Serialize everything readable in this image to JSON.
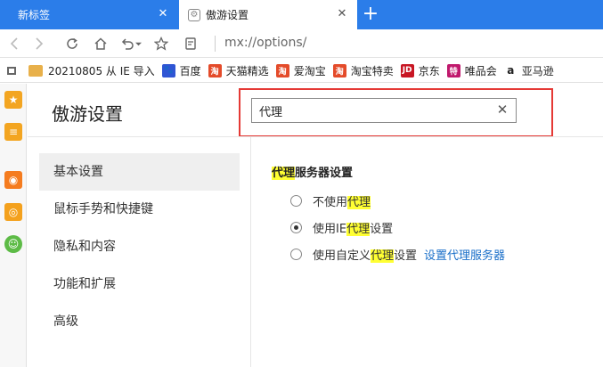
{
  "tabs": [
    {
      "title": "新标签",
      "close": "✕"
    },
    {
      "title": "傲游设置",
      "close": "✕"
    }
  ],
  "new_tab_label": "+",
  "address": {
    "url": "mx://options/"
  },
  "bookmarks": [
    {
      "label": "20210805 从 IE 导入",
      "icon": "folder-icon",
      "color": "#e8b04a"
    },
    {
      "label": "百度",
      "icon": "baidu-icon",
      "color": "#2f55d4"
    },
    {
      "label": "天猫精选",
      "icon": "tmall-icon",
      "color": "#e44b2a"
    },
    {
      "label": "爱淘宝",
      "icon": "taobao-icon",
      "color": "#e44b2a"
    },
    {
      "label": "淘宝特卖",
      "icon": "taobao-icon",
      "color": "#e44b2a"
    },
    {
      "label": "京东",
      "icon": "jd-icon",
      "color": "#c81623"
    },
    {
      "label": "唯品会",
      "icon": "vip-icon",
      "color": "#c0196d"
    },
    {
      "label": "亚马逊",
      "icon": "amazon-icon",
      "color": "#222222"
    }
  ],
  "settings": {
    "title": "傲游设置",
    "search": {
      "value": "代理",
      "clear": "✕"
    },
    "menu": [
      {
        "label": "基本设置",
        "selected": true
      },
      {
        "label": "鼠标手势和快捷键"
      },
      {
        "label": "隐私和内容"
      },
      {
        "label": "功能和扩展"
      },
      {
        "label": "高级"
      }
    ],
    "proxy": {
      "title_hl": "代理",
      "title_rest": "服务器设置",
      "options": [
        {
          "pre": "不使用",
          "hl": "代理",
          "post": "",
          "checked": false
        },
        {
          "pre": "使用IE",
          "hl": "代理",
          "post": "设置",
          "checked": true
        },
        {
          "pre": "使用自定义",
          "hl": "代理",
          "post": "设置",
          "checked": false,
          "link": "设置代理服务器"
        }
      ]
    }
  },
  "colors": {
    "accent": "#2b7de9",
    "highlight": "#ffff33",
    "annotation": "#e53935",
    "link": "#1a6fc9"
  }
}
